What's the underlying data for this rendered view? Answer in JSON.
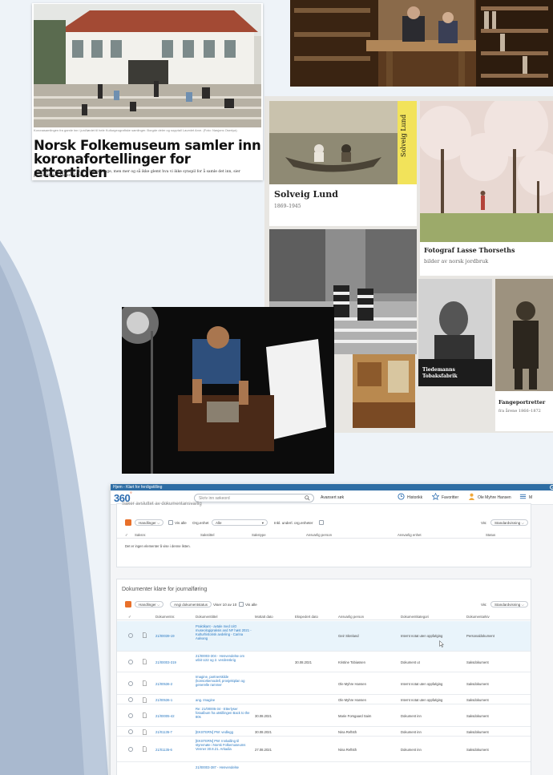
{
  "newspaper": {
    "caption": "Koronasamlingen fra gamle inn i juni/lørdet til hele Kulturgeografiske samlinger. Borgde deler og sopptall Laumlet Arve. (Foto: Nasjons Oseriya)",
    "headline": "Norsk Folkemuseum samler inn koronafortellinger for ettertiden",
    "lead": "- Nye av dette kommer vi til å huske lenge, men mer og så ikke glemt hva vi ikke synspil for å samle det inn, sier prosjektleder Anders Kass."
  },
  "collage": {
    "tiles": [
      {
        "title": "Solveig Lund",
        "subtitle": "1869–1945",
        "label": "Solveig Lund"
      },
      {
        "title": "Fotograf Lasse Thorseths",
        "subtitle": "bilder av norsk jordbruk"
      },
      {
        "title": "Tiedemanns Tobaksfabrik"
      },
      {
        "title": "Fangeportretter",
        "subtitle": "fra årene 1866–1872"
      }
    ]
  },
  "app": {
    "breadcrumb": "Hjem - Klart for ferdigstilling",
    "help_icon": "?",
    "logo": "360",
    "logo_mark": "°",
    "search_placeholder": "Skriv inn søkeord",
    "advanced_search": "Avansert søk",
    "history": "Historikk",
    "favorites": "Favoritter",
    "user": "Ole Myhre Hansen",
    "menu_label": "M",
    "panel1": {
      "title_partial": "Saker avsluttet av dokumentansvarlig",
      "actions": "Handlinger ⌵",
      "show_all": "Vis alle",
      "org_unit_label": "Org.enhet",
      "org_unit_value": "Alle",
      "incl_sub": "Inkl. underl. org.enheter",
      "view_label": "Vis:",
      "view_value": "Standardvisning ⌵",
      "columns": [
        "Saksnr.",
        "Sakstittel",
        "Sakstype",
        "Ansvarlig person",
        "Ansvarlig enhet",
        "Status"
      ],
      "empty": "Det er ingen elementer å vise i denne listen."
    },
    "panel2": {
      "title": "Dokumenter klare for journalføring",
      "actions": "Handlinger ⌵",
      "set_status": "Angi dokumentstatus",
      "count": "Viser 10 av 10",
      "show_all": "Vis alle",
      "view_label": "Vis:",
      "view_value": "Standardvisning ⌵",
      "columns": [
        "Dokumentnr.",
        "Dokumenttittel",
        "Mottatt dato",
        "Ekspedert dato",
        "Ansvarlig person",
        "Dokumentkategori",
        "Dokumentarkiv"
      ],
      "rows": [
        {
          "nr": "21/00039-19",
          "title": "Praktikant - avtale med UiO museologipraksis and NF høst 2021 - Kulturhistorisk avdeling - Carina Aalvang",
          "received": "",
          "sent": "",
          "person": "Geir Skreland",
          "category": "Internt notat uten oppfølging",
          "archive": "Personaldokument"
        },
        {
          "nr": "21/00003-319",
          "title": "21/00003-304 - Henvendelse om utbit U22 og 2. verdenskrig",
          "received": "",
          "sent": "30.08.2021",
          "person": "Kristine Tobiassen",
          "category": "Dokument ut",
          "archive": "Saksdokument"
        },
        {
          "nr": "21/00536-2",
          "title": "Imagine, partnerskilde (konsortiemodell, prosjektplan og generelle rammer",
          "received": "",
          "sent": "",
          "person": "Ole Myhre Hansen",
          "category": "Internt notat uten oppfølging",
          "archive": "Saksdokument"
        },
        {
          "nr": "21/00536-1",
          "title": "ang. Imagine",
          "received": "",
          "sent": "",
          "person": "Ole Myhre Hansen",
          "category": "Internt notat uten oppfølging",
          "archive": "Saksdokument"
        },
        {
          "nr": "21/00005-42",
          "title": "Re: 21/00005-34 - Etterlyser fotoalbum fra utstillingen Back to the 80s",
          "received": "30.08.2021",
          "sent": "",
          "person": "Marie Forsgaard Saim",
          "category": "Dokument inn",
          "archive": "Saksdokument"
        },
        {
          "nr": "21/01135-7",
          "title": "[EKSTERN] PW: vedlegg",
          "received": "30.08.2021",
          "sent": "",
          "person": "Nina Reftsth",
          "category": "Dokument inn",
          "archive": "Saksdokument"
        },
        {
          "nr": "21/01135-6",
          "title": "[EKSTERN] PW: Innkalling til styremøte i Norsk Folkemuseums Venner 30.8.21. Arkadia",
          "received": "27.08.2021",
          "sent": "",
          "person": "Nina Reftsth",
          "category": "Dokument inn",
          "archive": "Saksdokument"
        },
        {
          "nr": "",
          "title": "21/00003-387 - Henvendelse",
          "received": "",
          "sent": "",
          "person": "",
          "category": "",
          "archive": ""
        }
      ]
    }
  },
  "colors": {
    "accent": "#2b6cb0",
    "link": "#2a79c2",
    "rss": "#e8702a",
    "highlight": "#e9f4fb"
  }
}
